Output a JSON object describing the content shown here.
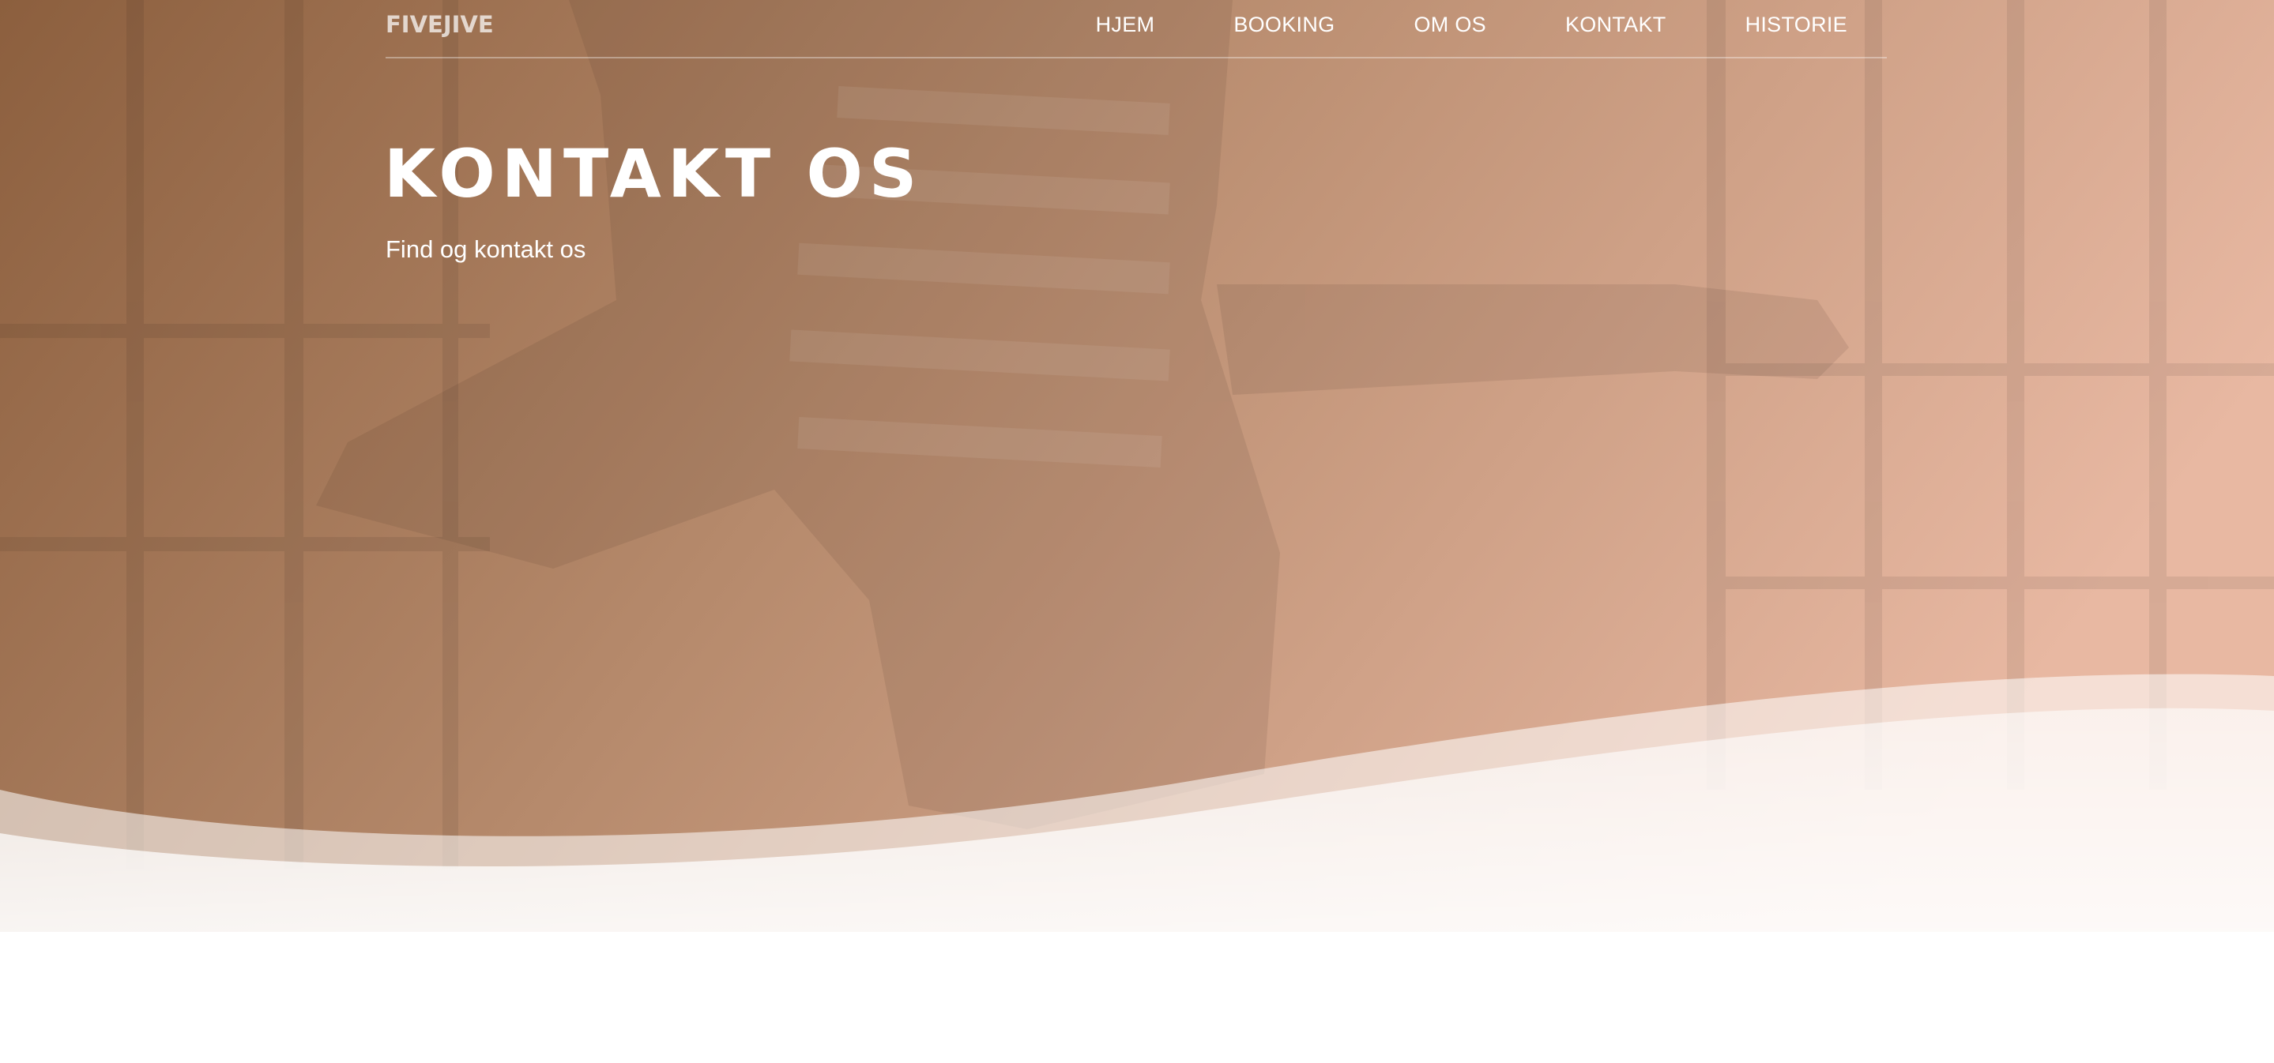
{
  "navbar": {
    "brand": "FIVEJIVE",
    "items": [
      {
        "label": "HJEM"
      },
      {
        "label": "BOOKING"
      },
      {
        "label": "OM OS"
      },
      {
        "label": "KONTAKT"
      },
      {
        "label": "HISTORIE"
      }
    ]
  },
  "hero": {
    "title": "KONTAKT OS",
    "subtitle": "Find og kontakt os"
  },
  "colors": {
    "gradient_start": "#8c5f3e",
    "gradient_end": "#e8b8a2",
    "page_background": "#ffffff"
  }
}
